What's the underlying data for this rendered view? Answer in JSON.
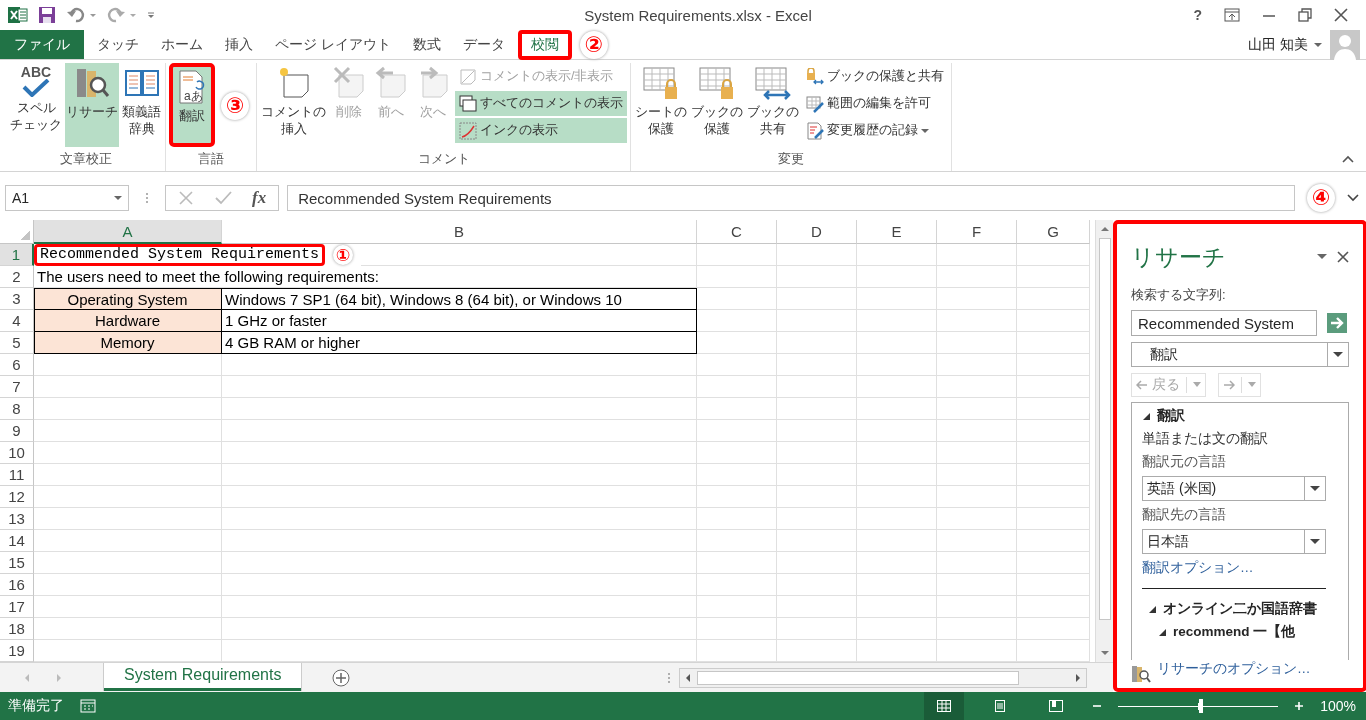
{
  "window": {
    "title": "System Requirements.xlsx - Excel",
    "help": "?"
  },
  "tabs": [
    {
      "label": "ファイル",
      "kind": "file",
      "selected": false
    },
    {
      "label": "タッチ",
      "kind": "tab",
      "selected": false
    },
    {
      "label": "ホーム",
      "kind": "tab",
      "selected": false
    },
    {
      "label": "挿入",
      "kind": "tab",
      "selected": false
    },
    {
      "label": "ページ レイアウト",
      "kind": "tab",
      "selected": false
    },
    {
      "label": "数式",
      "kind": "tab",
      "selected": false
    },
    {
      "label": "データ",
      "kind": "tab",
      "selected": false
    },
    {
      "label": "校閲",
      "kind": "tab",
      "selected": true,
      "step": "②"
    }
  ],
  "user": {
    "name": "山田 知美"
  },
  "ribbon": {
    "groups": [
      {
        "label": "文章校正",
        "items": [
          {
            "lines": [
              "スペル",
              "チェック"
            ],
            "glyph": "ABC",
            "selected": false,
            "disabled": false
          },
          {
            "lines": [
              "リサーチ"
            ],
            "selected": true,
            "disabled": false
          },
          {
            "lines": [
              "類義語",
              "辞典"
            ],
            "selected": false,
            "disabled": false
          }
        ]
      },
      {
        "label": "言語",
        "items": [
          {
            "lines": [
              "翻訳"
            ],
            "glyph": "aあ",
            "selected": true,
            "disabled": false,
            "step": "③"
          }
        ]
      },
      {
        "label": "コメント",
        "items": [
          {
            "lines": [
              "コメントの",
              "挿入"
            ],
            "selected": false,
            "disabled": false
          },
          {
            "lines": [
              "削除"
            ],
            "selected": false,
            "disabled": true
          },
          {
            "lines": [
              "前へ"
            ],
            "selected": false,
            "disabled": true
          },
          {
            "lines": [
              "次へ"
            ],
            "selected": false,
            "disabled": true
          }
        ],
        "small_items": [
          {
            "label": "コメントの表示/非表示",
            "selected": false,
            "disabled": true,
            "menu": false
          },
          {
            "label": "すべてのコメントの表示",
            "selected": true,
            "disabled": false,
            "menu": false
          },
          {
            "label": "インクの表示",
            "selected": true,
            "disabled": false,
            "menu": false
          }
        ]
      },
      {
        "label": "変更",
        "items": [
          {
            "lines": [
              "シートの",
              "保護"
            ],
            "selected": false,
            "disabled": false
          },
          {
            "lines": [
              "ブックの",
              "保護"
            ],
            "selected": false,
            "disabled": false
          },
          {
            "lines": [
              "ブックの",
              "共有"
            ],
            "selected": false,
            "disabled": false
          }
        ],
        "small_items": [
          {
            "label": "ブックの保護と共有",
            "selected": false,
            "disabled": false,
            "menu": false
          },
          {
            "label": "範囲の編集を許可",
            "selected": false,
            "disabled": false,
            "menu": false
          },
          {
            "label": "変更履歴の記録",
            "selected": false,
            "disabled": false,
            "menu": true
          }
        ]
      }
    ]
  },
  "formula_bar": {
    "cell": "A1",
    "function_label": "fx",
    "value": "Recommended System Requirements"
  },
  "sheet": {
    "columns": [
      {
        "label": "A",
        "selected": true
      },
      {
        "label": "B",
        "selected": false
      },
      {
        "label": "C",
        "selected": false
      },
      {
        "label": "D",
        "selected": false
      },
      {
        "label": "E",
        "selected": false
      },
      {
        "label": "F",
        "selected": false
      },
      {
        "label": "G",
        "selected": false
      }
    ],
    "rows": [
      {
        "number": "1",
        "selected": true,
        "cells": [
          {
            "text": "Recommended System Requirements",
            "kind": "title",
            "step": "①"
          }
        ]
      },
      {
        "number": "2",
        "selected": false,
        "cells": [
          {
            "text": "The users need to meet the following requirements:",
            "kind": "note"
          }
        ]
      },
      {
        "number": "3",
        "selected": false,
        "cells": [
          {
            "text": "Operating System",
            "kind": "label"
          },
          {
            "text": "Windows 7 SP1 (64 bit), Windows 8 (64 bit), or Windows 10",
            "kind": "value"
          }
        ]
      },
      {
        "number": "4",
        "selected": false,
        "cells": [
          {
            "text": "Hardware",
            "kind": "label"
          },
          {
            "text": "1 GHz or faster",
            "kind": "value"
          }
        ]
      },
      {
        "number": "5",
        "selected": false,
        "cells": [
          {
            "text": "Memory",
            "kind": "label"
          },
          {
            "text": "4 GB RAM or higher",
            "kind": "value"
          }
        ]
      },
      {
        "number": "6",
        "selected": false
      },
      {
        "number": "7",
        "selected": false
      },
      {
        "number": "8",
        "selected": false
      },
      {
        "number": "9",
        "selected": false
      },
      {
        "number": "10",
        "selected": false
      },
      {
        "number": "11",
        "selected": false
      },
      {
        "number": "12",
        "selected": false
      },
      {
        "number": "13",
        "selected": false
      },
      {
        "number": "14",
        "selected": false
      },
      {
        "number": "15",
        "selected": false
      },
      {
        "number": "16",
        "selected": false
      },
      {
        "number": "17",
        "selected": false
      },
      {
        "number": "18",
        "selected": false
      },
      {
        "number": "19",
        "selected": false
      }
    ]
  },
  "sheet_tabs": [
    {
      "label": "System Requirements",
      "selected": true
    }
  ],
  "research_pane": {
    "step": "④",
    "title": "リサーチ",
    "search_label": "検索する文字列:",
    "search_value": "Recommended System",
    "service": "翻訳",
    "nav": [
      {
        "label": "戻る",
        "disabled": true
      },
      {
        "disabled": true
      }
    ],
    "section": {
      "title": "翻訳",
      "expanded": true
    },
    "description": "単語または文の翻訳",
    "source_label": "翻訳元の言語",
    "source": "英語 (米国)",
    "target_label": "翻訳先の言語",
    "target": "日本語",
    "options_link": "翻訳オプション…",
    "dictionary": {
      "title": "オンライン二か国語辞書",
      "expanded": true,
      "entry": {
        "title": "recommend 一【他",
        "expanded": true
      }
    },
    "footer_link": "リサーチのオプション…"
  },
  "status_bar": {
    "status": "準備完了",
    "views": [
      {
        "selected": true
      },
      {
        "selected": false
      },
      {
        "selected": false
      }
    ],
    "zoom": {
      "level": 0.52,
      "reading": "100%"
    }
  }
}
